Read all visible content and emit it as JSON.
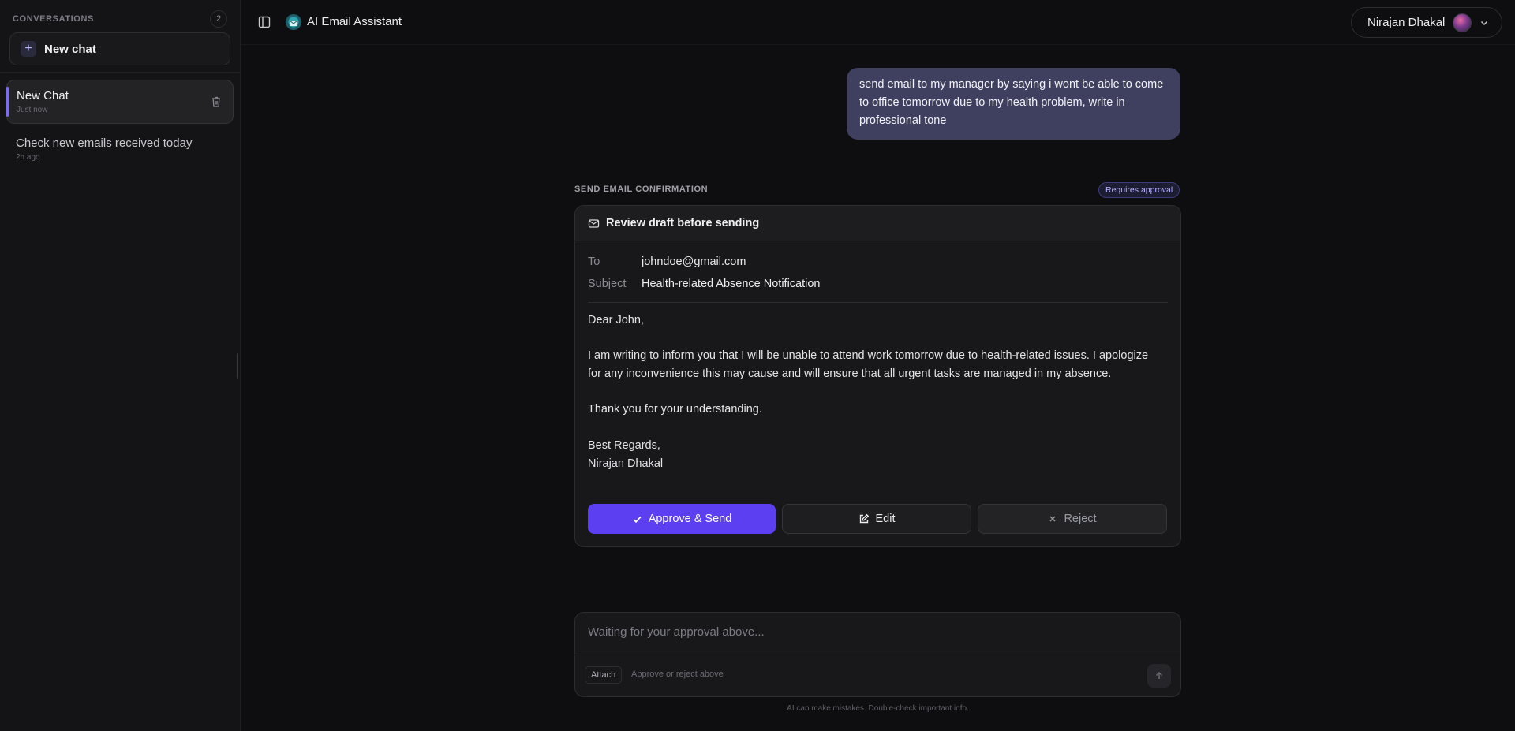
{
  "sidebar": {
    "title": "CONVERSATIONS",
    "count": "2",
    "new_chat_label": "New chat",
    "conversations": [
      {
        "title": "New Chat",
        "time": "Just now",
        "active": true
      },
      {
        "title": "Check new emails received today",
        "time": "2h ago",
        "active": false
      }
    ]
  },
  "header": {
    "app_title": "AI Email Assistant",
    "user_name": "Nirajan Dhakal"
  },
  "chat": {
    "user_message": "send email to my manager by saying i wont be able to come to office tomorrow due to my health problem, write in professional tone"
  },
  "confirmation": {
    "section_label": "SEND EMAIL CONFIRMATION",
    "badge": "Requires approval",
    "card_title": "Review draft before sending",
    "to_label": "To",
    "to_value": "johndoe@gmail.com",
    "subject_label": "Subject",
    "subject_value": "Health-related Absence Notification",
    "body": {
      "greeting": "Dear John,",
      "paragraph": "I am writing to inform you that I will be unable to attend work tomorrow due to health-related issues. I apologize for any inconvenience this may cause and will ensure that all urgent tasks are managed in my absence.",
      "thanks": "Thank you for your understanding.",
      "closing": "Best Regards,",
      "signature": "Nirajan Dhakal"
    },
    "actions": {
      "approve": "Approve & Send",
      "edit": "Edit",
      "reject": "Reject"
    }
  },
  "composer": {
    "placeholder": "Waiting for your approval above...",
    "attach_label": "Attach",
    "hint": "Approve or reject above",
    "disclaimer": "AI can make mistakes. Double-check important info."
  },
  "colors": {
    "accent": "#5b3ff0",
    "user_bubble": "#3f4060",
    "background": "#0e0e10",
    "sidebar": "#141416"
  },
  "icons": [
    "panel-toggle-icon",
    "logo-icon",
    "chevron-down-icon",
    "plus-icon",
    "trash-icon",
    "mail-icon",
    "check-icon",
    "edit-icon",
    "close-icon",
    "arrow-up-icon"
  ]
}
